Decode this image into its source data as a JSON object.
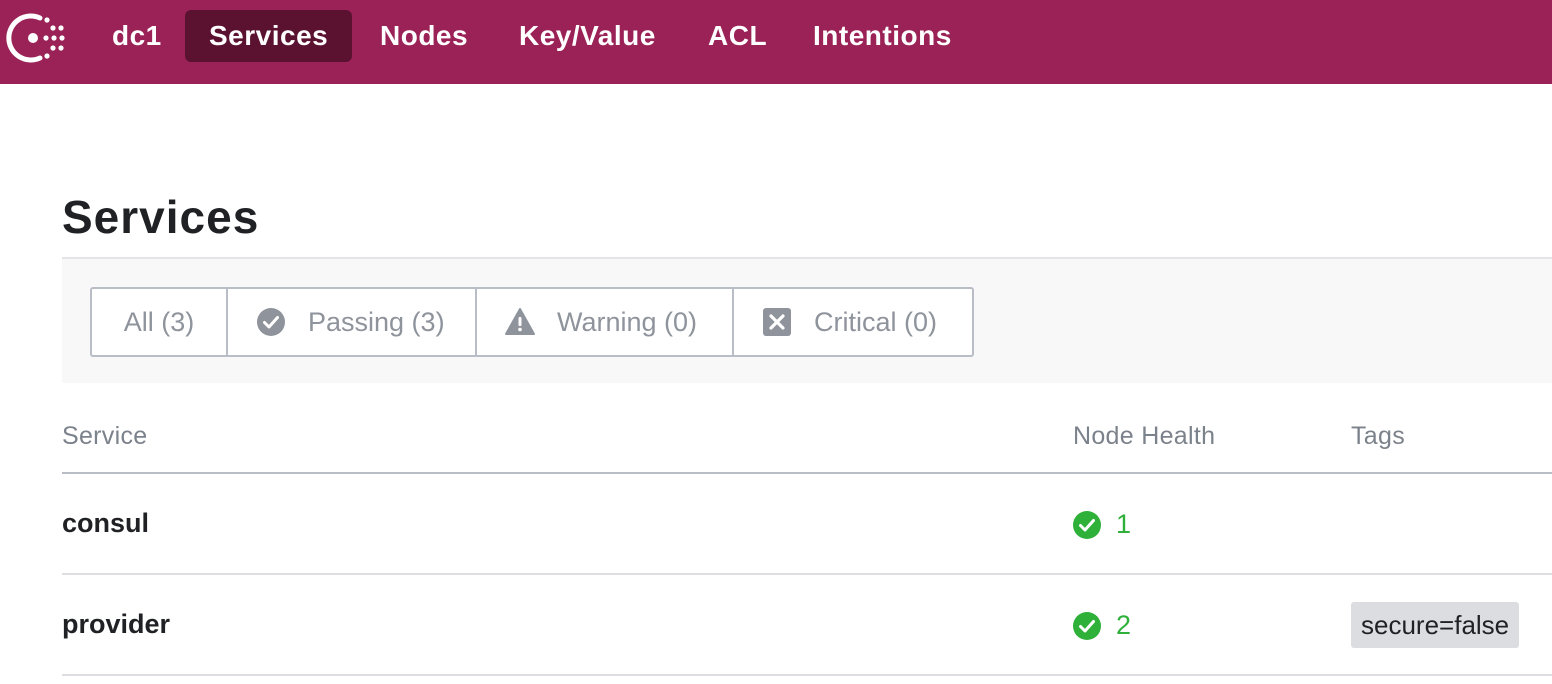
{
  "nav": {
    "datacenter": "dc1",
    "items": [
      {
        "label": "Services",
        "active": true
      },
      {
        "label": "Nodes"
      },
      {
        "label": "Key/Value"
      },
      {
        "label": "ACL"
      },
      {
        "label": "Intentions"
      }
    ]
  },
  "page": {
    "title": "Services"
  },
  "filters": [
    {
      "label": "All (3)",
      "icon": "none",
      "selected": true
    },
    {
      "label": "Passing (3)",
      "icon": "check-circle-icon"
    },
    {
      "label": "Warning (0)",
      "icon": "warning-triangle-icon"
    },
    {
      "label": "Critical (0)",
      "icon": "x-square-icon"
    }
  ],
  "table": {
    "headers": {
      "service": "Service",
      "health": "Node Health",
      "tags": "Tags"
    },
    "rows": [
      {
        "service": "consul",
        "health_count": "1",
        "health_status": "passing",
        "tags": []
      },
      {
        "service": "provider",
        "health_count": "2",
        "health_status": "passing",
        "tags": [
          "secure=false"
        ]
      }
    ]
  },
  "colors": {
    "brand": "#9b2257",
    "nav_active": "#5b1130",
    "passing": "#2eb039",
    "muted": "#8e939c"
  }
}
